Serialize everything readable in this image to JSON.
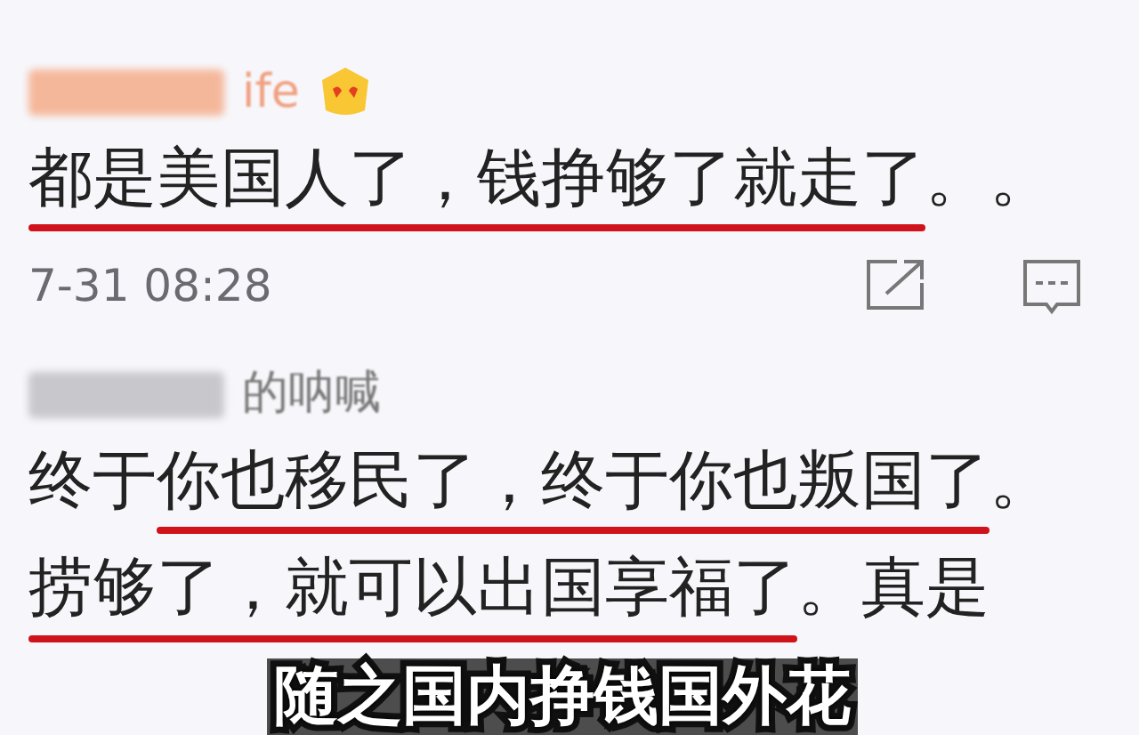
{
  "comments": [
    {
      "author_blurred": true,
      "author_visible": "ife",
      "badge": true,
      "lines": [
        [
          {
            "text": "都是美国人了，钱挣够了就走了",
            "underlined": true
          },
          {
            "text": "。。",
            "underlined": false
          }
        ]
      ],
      "time": "7-31 08:28"
    },
    {
      "author_blurred": true,
      "author_visible": "的呐喊",
      "lines": [
        [
          {
            "text": "终于",
            "underlined": false
          },
          {
            "text": "你也移民了，终于你也叛国了",
            "underlined": true
          },
          {
            "text": "。",
            "underlined": false
          }
        ],
        [
          {
            "text": "捞够了，就可以出国享福了",
            "underlined": true
          },
          {
            "text": "。真是",
            "underlined": false
          }
        ]
      ]
    }
  ],
  "caption": "随之国内挣钱国外花"
}
